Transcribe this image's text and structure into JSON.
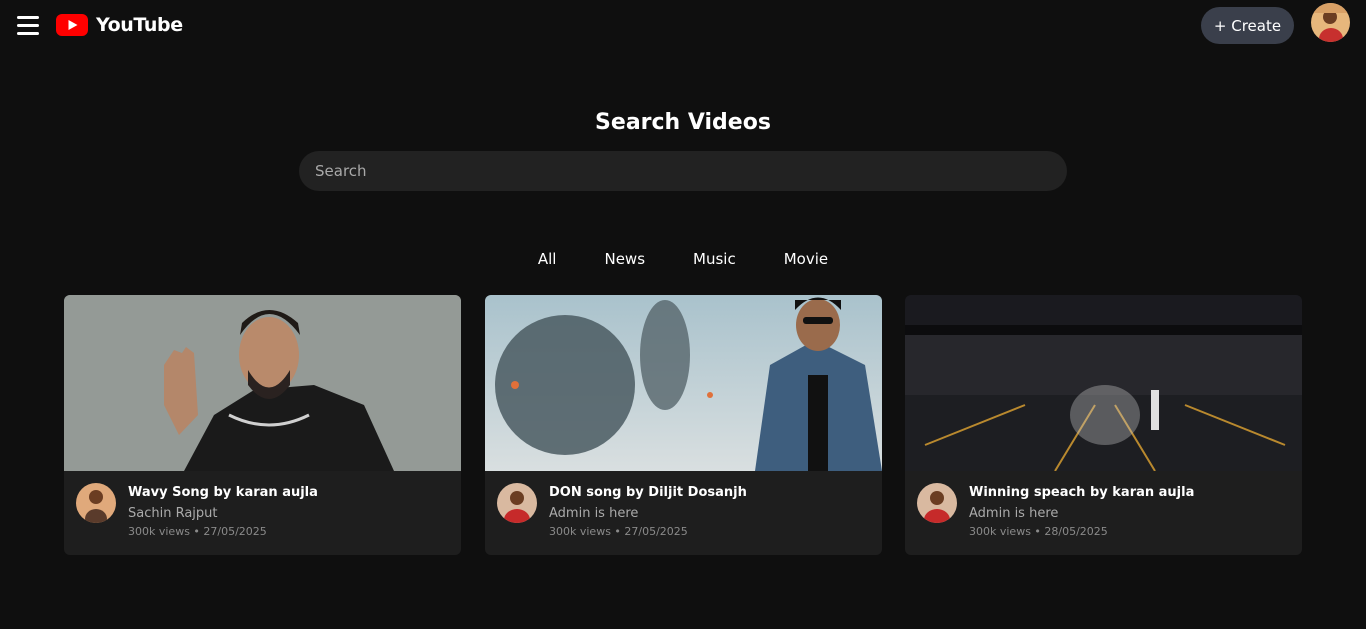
{
  "app": {
    "name": "YouTube",
    "brand_color": "#ff0000"
  },
  "header": {
    "menu_icon": "hamburger-icon",
    "create_label": "+ Create"
  },
  "search": {
    "title": "Search Videos",
    "placeholder": "Search",
    "value": ""
  },
  "tabs": [
    "All",
    "News",
    "Music",
    "Movie"
  ],
  "videos": [
    {
      "title": "Wavy Song by karan aujla",
      "channel": "Sachin Rajput",
      "meta": "300k views • 27/05/2025"
    },
    {
      "title": "DON song by Diljit Dosanjh",
      "channel": "Admin is here",
      "meta": "300k views • 27/05/2025"
    },
    {
      "title": "Winning speach by karan aujla",
      "channel": "Admin is here",
      "meta": "300k views • 28/05/2025"
    }
  ]
}
